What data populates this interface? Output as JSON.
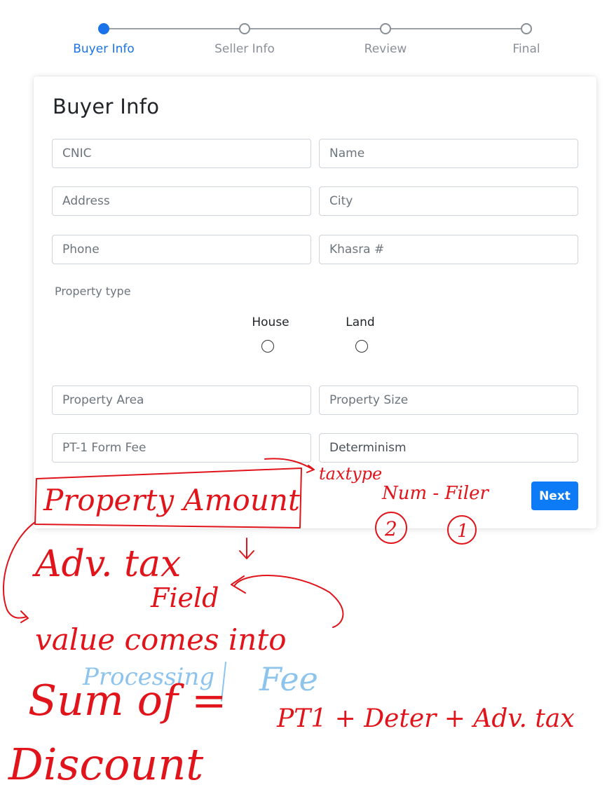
{
  "stepper": {
    "steps": [
      {
        "label": "Buyer Info",
        "active": true
      },
      {
        "label": "Seller Info",
        "active": false
      },
      {
        "label": "Review",
        "active": false
      },
      {
        "label": "Final",
        "active": false
      }
    ]
  },
  "form": {
    "title": "Buyer Info",
    "fields": {
      "cnic": {
        "placeholder": "CNIC",
        "value": ""
      },
      "name": {
        "placeholder": "Name",
        "value": ""
      },
      "address": {
        "placeholder": "Address",
        "value": ""
      },
      "city": {
        "placeholder": "City",
        "value": ""
      },
      "phone": {
        "placeholder": "Phone",
        "value": ""
      },
      "khasra": {
        "placeholder": "Khasra #",
        "value": ""
      },
      "property_area": {
        "placeholder": "Property Area",
        "value": ""
      },
      "property_size": {
        "placeholder": "Property Size",
        "value": ""
      },
      "pt1_form_fee": {
        "placeholder": "PT-1 Form Fee",
        "value": ""
      },
      "determinism": {
        "placeholder": "",
        "value": "Determinism"
      }
    },
    "property_type": {
      "label": "Property type",
      "options": [
        {
          "label": "House",
          "checked": false
        },
        {
          "label": "Land",
          "checked": false
        }
      ]
    },
    "next_label": "Next"
  },
  "annotations": {
    "property_amount": "Property Amount",
    "taxtype": "taxtype",
    "num_filer": "Num - Filer",
    "circle_2": "2",
    "circle_1": "1",
    "adv_tax": "Adv. tax",
    "field": "Field",
    "value_comes_into": "value comes into",
    "processing": "Processing",
    "fee": "Fee",
    "sum_of": "Sum of =",
    "formula": "PT1 + Deter + Adv. tax",
    "discount": "Discount"
  },
  "colors": {
    "accent": "#1a73e8",
    "button": "#0d7bf5",
    "ink_red": "#e0141a",
    "ink_blue": "#8cc4ee"
  }
}
